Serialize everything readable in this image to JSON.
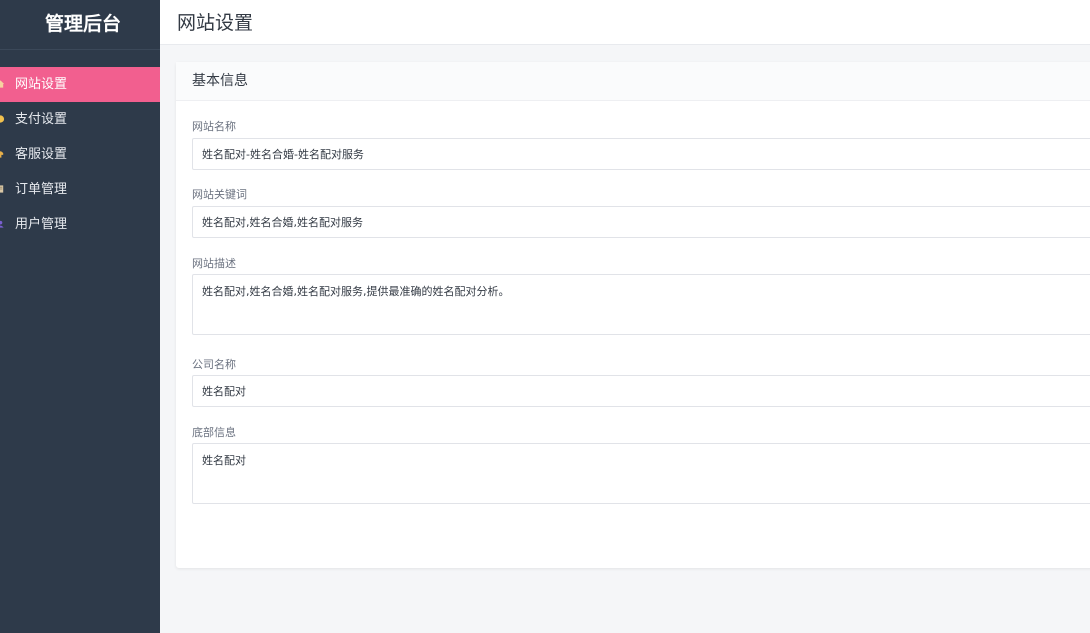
{
  "sidebar": {
    "brand": "管理后台",
    "items": [
      {
        "label": "网站设置",
        "icon": "home-icon",
        "active": true
      },
      {
        "label": "支付设置",
        "icon": "coin-icon",
        "active": false
      },
      {
        "label": "客服设置",
        "icon": "headset-icon",
        "active": false
      },
      {
        "label": "订单管理",
        "icon": "order-icon",
        "active": false
      },
      {
        "label": "用户管理",
        "icon": "user-icon",
        "active": false
      }
    ]
  },
  "header": {
    "title": "网站设置"
  },
  "card": {
    "title": "基本信息",
    "fields": {
      "site_name": {
        "label": "网站名称",
        "value": "姓名配对-姓名合婚-姓名配对服务"
      },
      "site_keywords": {
        "label": "网站关键词",
        "value": "姓名配对,姓名合婚,姓名配对服务"
      },
      "site_description": {
        "label": "网站描述",
        "value": "姓名配对,姓名合婚,姓名配对服务,提供最准确的姓名配对分析。"
      },
      "company_name": {
        "label": "公司名称",
        "value": "姓名配对"
      },
      "footer_info": {
        "label": "底部信息",
        "value": "姓名配对"
      }
    }
  },
  "colors": {
    "sidebar_bg": "#2e3a4a",
    "active_item": "#f25f8f",
    "page_bg": "#f5f6f8"
  }
}
